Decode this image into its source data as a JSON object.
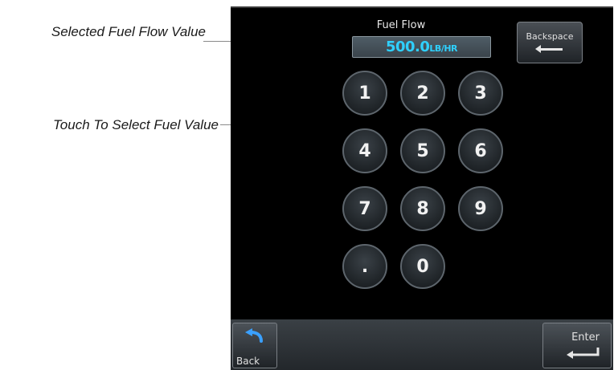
{
  "annotations": {
    "selected_value": "Selected Fuel Flow Value",
    "select_hint": "Touch To Select Fuel Value"
  },
  "screen": {
    "title": "Fuel Flow",
    "value": "500.0",
    "unit": "LB/HR",
    "backspace_label": "Backspace",
    "keys": [
      "1",
      "2",
      "3",
      "4",
      "5",
      "6",
      "7",
      "8",
      "9",
      ".",
      "0"
    ],
    "back_label": "Back",
    "enter_label": "Enter"
  },
  "colors": {
    "value_text": "#2fd0ff",
    "background": "#000000"
  },
  "icons": {
    "backspace": "arrow-left-icon",
    "back": "curved-back-arrow-icon",
    "enter": "enter-return-icon"
  }
}
